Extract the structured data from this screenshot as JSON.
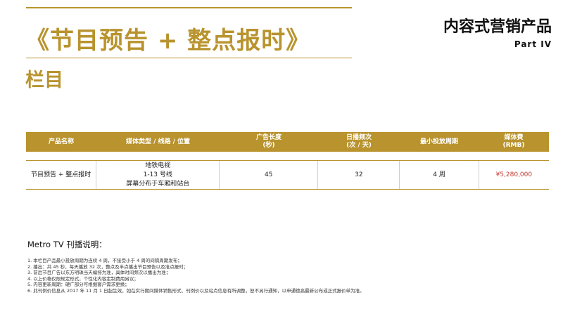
{
  "header": {
    "title": "《节目预告 + 整点报时》",
    "subtitle": "栏目",
    "part_title": "内容式营销产品",
    "part_no": "Part IV"
  },
  "table": {
    "headers": [
      [
        "产品名称"
      ],
      [
        "媒体类型 / 线路 / 位置"
      ],
      [
        "广告长度",
        "(秒)"
      ],
      [
        "日播频次",
        "(次 / 天)"
      ],
      [
        "最小投放周期"
      ],
      [
        "媒体费",
        "(RMB)"
      ]
    ],
    "row": {
      "name": "节目预告 + 整点报时",
      "media": [
        "地铁电视",
        "1-13 号线",
        "屏幕分布于车厢和站台"
      ],
      "length": "45",
      "frequency": "32",
      "period": "4 周",
      "price": "¥5,280,000"
    }
  },
  "notes": {
    "title": "Metro TV 刊播说明：",
    "items": [
      "1. 本栏目产品最小投放周期为连续 4 周，不接受小于 4 周的间隔周期发布；",
      "2. 播出：共 45 秒，每天播放 32 次，整点及半点播出节目预告以及准点报时；",
      "3. 前后节目广告以东方明珠当天编排为准，具体时间频次以播出为准；",
      "4. 以上价格仅限规定形式，个性化内容定制费用另议；",
      "5. 内容更新周期：硬广部分可根据客户需求更换；",
      "6. 此刊例价信息从 2017 年 11 月 1 日起生效，如在实行期间媒体销售形式、刊例价以及站点信息有所调整，恕不另行通知，以申通德高最新公布或正式报价单为准。"
    ]
  },
  "colors": {
    "gold": "#b8932e",
    "price": "#c0392b"
  }
}
